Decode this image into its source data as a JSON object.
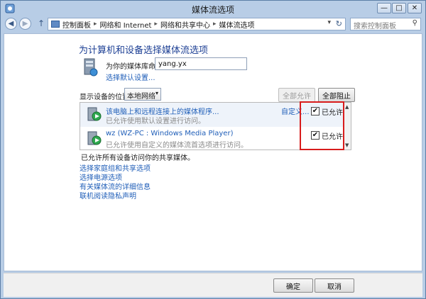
{
  "window": {
    "title": "媒体流选项",
    "controls": {
      "minimize": "—",
      "maximize": "□",
      "close": "✕"
    }
  },
  "navbar": {
    "back_icon": "◀",
    "forward_icon": "▶",
    "up_icon": "↑",
    "breadcrumbs": [
      "控制面板",
      "网络和 Internet",
      "网络和共享中心",
      "媒体流选项"
    ],
    "separator": "▸",
    "dropdown_icon": "▾",
    "refresh_icon": "↻",
    "search_placeholder": "搜索控制面板",
    "search_icon": "⚲"
  },
  "main": {
    "heading": "为计算机和设备选择媒体流选项",
    "library_name_label": "为你的媒体库命名:",
    "library_name_value": "yang.yx",
    "choose_default_link": "选择默认设置...",
    "show_devices_label": "显示设备的位置:",
    "location_value": "本地网络",
    "allow_all_button": "全部允许",
    "block_all_button": "全部阻止",
    "devices": [
      {
        "name": "该电脑上和远程连接上的媒体程序...",
        "description": "已允许使用默认设置进行访问。",
        "customize": "自定义...",
        "allowed_label": "已允许",
        "checked": "✔"
      },
      {
        "name": "wz (WZ-PC : Windows Media Player)",
        "description": "已允许使用自定义的媒体流首选项进行访问。",
        "customize": "",
        "allowed_label": "已允许",
        "checked": "✔"
      }
    ],
    "allow_summary": "已允许所有设备访问你的共享媒体。",
    "links": [
      "选择家庭组和共享选项",
      "选择电源选项",
      "有关媒体流的详细信息",
      "联机阅读隐私声明"
    ]
  },
  "footer": {
    "ok_button": "确定",
    "cancel_button": "取消"
  },
  "colors": {
    "link": "#1f5eb8",
    "highlight": "#d81c1c",
    "frame": "#b8cde6"
  }
}
